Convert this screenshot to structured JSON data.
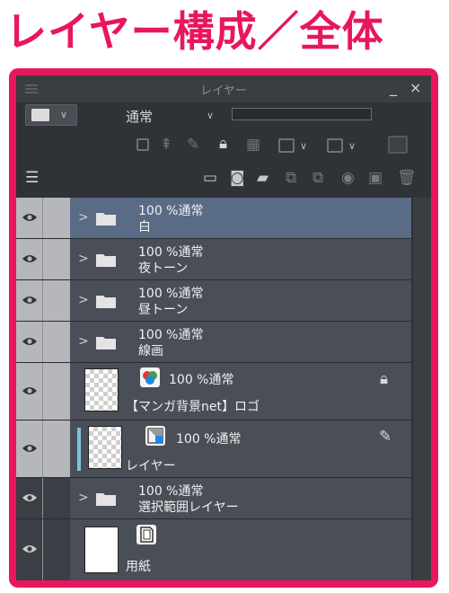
{
  "heading": "レイヤー構成／全体",
  "panel": {
    "title": "レイヤー",
    "minimize": "_",
    "close": "×",
    "blend_mode": "通常",
    "chevron": "∨"
  },
  "layers": [
    {
      "opacity_mode": "100 %通常",
      "name": "白",
      "type": "folder",
      "selected": true,
      "edit_icon": "pen-icon"
    },
    {
      "opacity_mode": "100 %通常",
      "name": "夜トーン",
      "type": "folder"
    },
    {
      "opacity_mode": "100 %通常",
      "name": "昼トーン",
      "type": "folder"
    },
    {
      "opacity_mode": "100 %通常",
      "name": "線画",
      "type": "folder"
    },
    {
      "opacity_mode": "100 %通常",
      "name": "【マンガ背景net】ロゴ",
      "type": "image",
      "locked": true
    },
    {
      "opacity_mode": "100 %通常",
      "name": "レイヤー",
      "type": "raster",
      "clip_icon": "clip-lower-icon"
    },
    {
      "opacity_mode": "100 %通常",
      "name": "選択範囲レイヤー",
      "type": "folder"
    },
    {
      "opacity_mode": "",
      "name": "用紙",
      "type": "paper"
    }
  ],
  "colors": {
    "accent": "#e8175d",
    "panel_bg": "#2f3236",
    "layer_bg": "#4a4e57",
    "selected_bg": "#5a6b86",
    "column_light": "#b5b7ba"
  }
}
